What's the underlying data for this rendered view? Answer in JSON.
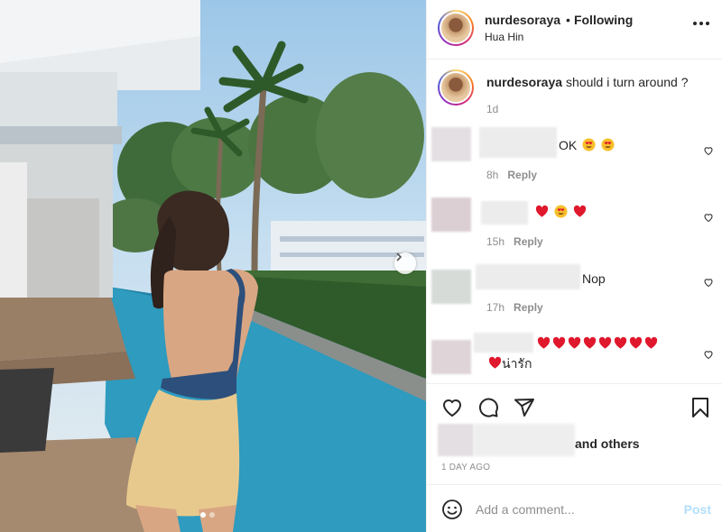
{
  "post": {
    "username": "nurdesoraya",
    "follow_status": "Following",
    "separator": "•",
    "location": "Hua Hin",
    "caption": "should i turn around ?",
    "caption_time": "1d"
  },
  "comments": [
    {
      "text": "OK",
      "time": "8h",
      "reply": "Reply"
    },
    {
      "text": "",
      "time": "15h",
      "reply": "Reply"
    },
    {
      "text": "Nop",
      "time": "17h",
      "reply": "Reply"
    },
    {
      "text": "น่ารัก",
      "time": "",
      "reply": ""
    }
  ],
  "likes": {
    "text": "and others"
  },
  "post_date": "1 DAY AGO",
  "add_comment": {
    "placeholder": "Add a comment...",
    "post_label": "Post"
  },
  "carousel": {
    "count": 2,
    "active": 1
  },
  "colors": {
    "post_button": "#b2dffc",
    "heart_emoji": "#e0182d",
    "meta_text": "#8e8e8e"
  },
  "icons": [
    "more-icon",
    "heart-icon",
    "comment-icon",
    "share-icon",
    "bookmark-icon",
    "smile-icon",
    "chevron-right-icon"
  ]
}
